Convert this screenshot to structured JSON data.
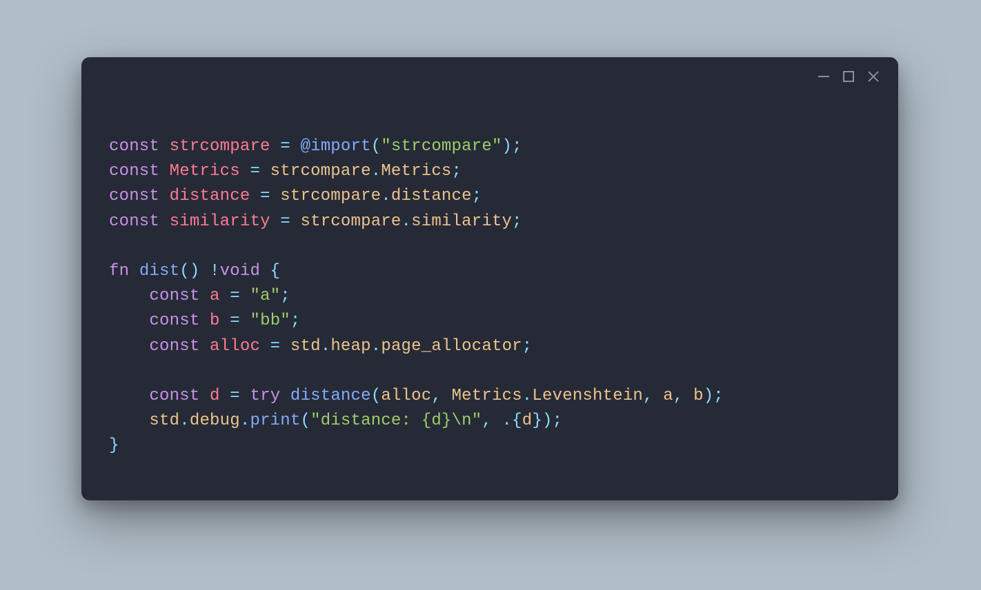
{
  "window": {
    "controls": {
      "minimize_title": "Minimize",
      "maximize_title": "Maximize",
      "close_title": "Close"
    }
  },
  "colors": {
    "background_page": "#b1bdc7",
    "background_window": "#262a36",
    "titlebar_icon": "#8a8f9c",
    "keyword": "#c792ea",
    "type": "#ff7a93",
    "identifier": "#ecc48d",
    "function": "#82aaff",
    "string": "#9ece6a",
    "operator": "#89ddff",
    "default": "#c9cdd6"
  },
  "code": {
    "language": "zig",
    "lines": [
      [
        {
          "t": "const ",
          "c": "kw"
        },
        {
          "t": "strcompare ",
          "c": "type"
        },
        {
          "t": "= ",
          "c": "op"
        },
        {
          "t": "@import",
          "c": "fn"
        },
        {
          "t": "(",
          "c": "op"
        },
        {
          "t": "\"strcompare\"",
          "c": "str"
        },
        {
          "t": ");",
          "c": "op"
        }
      ],
      [
        {
          "t": "const ",
          "c": "kw"
        },
        {
          "t": "Metrics ",
          "c": "type"
        },
        {
          "t": "= ",
          "c": "op"
        },
        {
          "t": "strcompare",
          "c": "id"
        },
        {
          "t": ".",
          "c": "op"
        },
        {
          "t": "Metrics",
          "c": "id"
        },
        {
          "t": ";",
          "c": "op"
        }
      ],
      [
        {
          "t": "const ",
          "c": "kw"
        },
        {
          "t": "distance ",
          "c": "type"
        },
        {
          "t": "= ",
          "c": "op"
        },
        {
          "t": "strcompare",
          "c": "id"
        },
        {
          "t": ".",
          "c": "op"
        },
        {
          "t": "distance",
          "c": "id"
        },
        {
          "t": ";",
          "c": "op"
        }
      ],
      [
        {
          "t": "const ",
          "c": "kw"
        },
        {
          "t": "similarity ",
          "c": "type"
        },
        {
          "t": "= ",
          "c": "op"
        },
        {
          "t": "strcompare",
          "c": "id"
        },
        {
          "t": ".",
          "c": "op"
        },
        {
          "t": "similarity",
          "c": "id"
        },
        {
          "t": ";",
          "c": "op"
        }
      ],
      [],
      [
        {
          "t": "fn ",
          "c": "kw"
        },
        {
          "t": "dist",
          "c": "fn"
        },
        {
          "t": "() ",
          "c": "op"
        },
        {
          "t": "!",
          "c": "err"
        },
        {
          "t": "void ",
          "c": "void"
        },
        {
          "t": "{",
          "c": "op"
        }
      ],
      [
        {
          "t": "    ",
          "c": ""
        },
        {
          "t": "const ",
          "c": "kw"
        },
        {
          "t": "a ",
          "c": "type"
        },
        {
          "t": "= ",
          "c": "op"
        },
        {
          "t": "\"a\"",
          "c": "str"
        },
        {
          "t": ";",
          "c": "op"
        }
      ],
      [
        {
          "t": "    ",
          "c": ""
        },
        {
          "t": "const ",
          "c": "kw"
        },
        {
          "t": "b ",
          "c": "type"
        },
        {
          "t": "= ",
          "c": "op"
        },
        {
          "t": "\"bb\"",
          "c": "str"
        },
        {
          "t": ";",
          "c": "op"
        }
      ],
      [
        {
          "t": "    ",
          "c": ""
        },
        {
          "t": "const ",
          "c": "kw"
        },
        {
          "t": "alloc ",
          "c": "type"
        },
        {
          "t": "= ",
          "c": "op"
        },
        {
          "t": "std",
          "c": "id"
        },
        {
          "t": ".",
          "c": "op"
        },
        {
          "t": "heap",
          "c": "id"
        },
        {
          "t": ".",
          "c": "op"
        },
        {
          "t": "page_allocator",
          "c": "id"
        },
        {
          "t": ";",
          "c": "op"
        }
      ],
      [],
      [
        {
          "t": "    ",
          "c": ""
        },
        {
          "t": "const ",
          "c": "kw"
        },
        {
          "t": "d ",
          "c": "type"
        },
        {
          "t": "= ",
          "c": "op"
        },
        {
          "t": "try ",
          "c": "kw"
        },
        {
          "t": "distance",
          "c": "fn"
        },
        {
          "t": "(",
          "c": "op"
        },
        {
          "t": "alloc",
          "c": "id"
        },
        {
          "t": ", ",
          "c": "op"
        },
        {
          "t": "Metrics",
          "c": "id"
        },
        {
          "t": ".",
          "c": "op"
        },
        {
          "t": "Levenshtein",
          "c": "id"
        },
        {
          "t": ", ",
          "c": "op"
        },
        {
          "t": "a",
          "c": "id"
        },
        {
          "t": ", ",
          "c": "op"
        },
        {
          "t": "b",
          "c": "id"
        },
        {
          "t": ");",
          "c": "op"
        }
      ],
      [
        {
          "t": "    ",
          "c": ""
        },
        {
          "t": "std",
          "c": "id"
        },
        {
          "t": ".",
          "c": "op"
        },
        {
          "t": "debug",
          "c": "id"
        },
        {
          "t": ".",
          "c": "op"
        },
        {
          "t": "print",
          "c": "fn"
        },
        {
          "t": "(",
          "c": "op"
        },
        {
          "t": "\"distance: {d}\\n\"",
          "c": "str"
        },
        {
          "t": ", .{",
          "c": "op"
        },
        {
          "t": "d",
          "c": "id"
        },
        {
          "t": "});",
          "c": "op"
        }
      ],
      [
        {
          "t": "}",
          "c": "op"
        }
      ]
    ]
  }
}
